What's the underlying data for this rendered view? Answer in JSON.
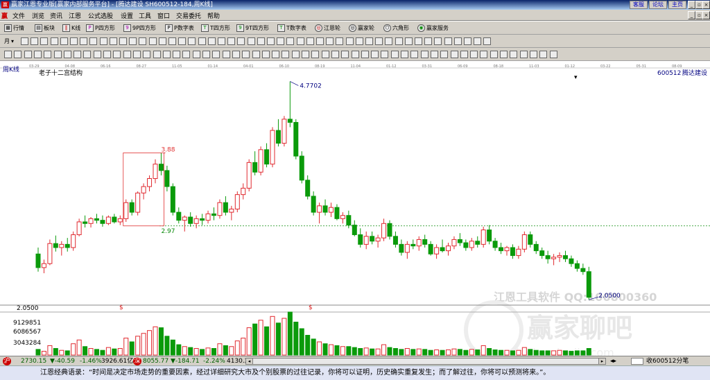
{
  "window": {
    "title": "赢家江恩专业版[赢家内部服务平台] - [腾达建设  SH600512-184,周K线]",
    "links": [
      "客服",
      "论坛",
      "主页"
    ],
    "logo_char": "赢"
  },
  "menu": [
    "文件",
    "浏览",
    "资讯",
    "江恩",
    "公式选股",
    "设置",
    "工具",
    "窗口",
    "交易委托",
    "帮助"
  ],
  "toolbar1": [
    "行情",
    "板块",
    "K线",
    "P四方形",
    "9P四方形",
    "P数字表",
    "T四方形",
    "9T四方形",
    "T数字表",
    "江恩轮",
    "赢家轮",
    "六角形",
    "赢家服务"
  ],
  "toolbar2": {
    "period": "月"
  },
  "chart_header": {
    "period_label": "周K线",
    "indicator": "老子十二宫结构",
    "code": "600512",
    "name": "腾达建设",
    "ann_high": "4.7702",
    "ann_box_high": "3.88",
    "ann_box_low": "2.97",
    "ann_low": "2.0500",
    "dollar": "$",
    "watermark1": "江恩工具软件 QQ:100800360",
    "watermark2": "赢家聊吧",
    "watermark3": "jiaoba.yingjia.com"
  },
  "colors": {
    "up": "#e0282e",
    "down": "#0a9a0a",
    "axis": "#000080",
    "dash_up": "#e03030",
    "dash_low": "#0a8a0a"
  },
  "date_axis": [
    "03-29",
    "04-08",
    "06-16",
    "08-27",
    "11-05",
    "01-14",
    "04-01",
    "06-10",
    "08-19",
    "11-04",
    "01-12",
    "03-31",
    "06-09",
    "08-18",
    "11-03",
    "01-12",
    "03-22",
    "05-31",
    "08-09"
  ],
  "volume_axis": [
    "9129851",
    "6086567",
    "3043284"
  ],
  "price_axis": "2.0500",
  "status": {
    "sh": "2730.15",
    "sh_change": "▼-40.59",
    "sh_pct": "-1.46%",
    "sh_amount": "3926.61亿",
    "sz": "8055.77",
    "sz_change": "▼-184.71",
    "sz_pct": "-2.24%",
    "sz_amount": "4130.2",
    "right_text": "收600512分笔",
    "logo_char": "沪",
    "logo2_char": "深"
  },
  "quote_text": "江恩经典语录：“时间是决定市场走势的重要因素，经过详细研究大市及个别股票的过往记录，你将可以证明，历史确实重复发生；而了解过往，你将可以预测将来。”。",
  "chart_data": {
    "type": "candlestick",
    "title": "老子十二宫结构",
    "xlabel": "",
    "ylabel": "",
    "ylim": [
      2.0,
      4.8
    ],
    "markers": {
      "high": 4.7702,
      "box_high": 3.88,
      "box_low": 2.97,
      "low": 2.05
    },
    "ohlc": [
      [
        2.62,
        2.7,
        2.4,
        2.45
      ],
      [
        2.45,
        2.55,
        2.38,
        2.5
      ],
      [
        2.5,
        2.8,
        2.48,
        2.75
      ],
      [
        2.75,
        2.85,
        2.65,
        2.7
      ],
      [
        2.7,
        2.78,
        2.6,
        2.74
      ],
      [
        2.74,
        2.82,
        2.65,
        2.7
      ],
      [
        2.7,
        2.9,
        2.66,
        2.86
      ],
      [
        2.86,
        3.06,
        2.84,
        3.02
      ],
      [
        3.02,
        3.1,
        2.95,
        3.0
      ],
      [
        3.0,
        3.08,
        2.95,
        3.06
      ],
      [
        3.06,
        3.12,
        3.0,
        3.04
      ],
      [
        3.04,
        3.1,
        2.96,
        3.0
      ],
      [
        3.0,
        3.1,
        2.98,
        3.08
      ],
      [
        3.08,
        3.12,
        3.0,
        3.02
      ],
      [
        3.02,
        3.1,
        2.98,
        3.06
      ],
      [
        3.06,
        3.3,
        3.02,
        3.26
      ],
      [
        3.26,
        3.3,
        3.1,
        3.14
      ],
      [
        3.14,
        3.4,
        3.1,
        3.38
      ],
      [
        3.38,
        3.5,
        3.3,
        3.46
      ],
      [
        3.46,
        3.6,
        3.4,
        3.56
      ],
      [
        3.56,
        3.8,
        3.5,
        3.74
      ],
      [
        3.74,
        3.88,
        3.6,
        3.66
      ],
      [
        3.66,
        3.72,
        3.4,
        3.46
      ],
      [
        3.46,
        3.5,
        3.1,
        3.14
      ],
      [
        3.14,
        3.2,
        3.0,
        3.04
      ],
      [
        3.04,
        3.1,
        2.9,
        3.08
      ],
      [
        3.08,
        3.14,
        2.96,
        3.0
      ],
      [
        3.0,
        3.1,
        2.94,
        3.06
      ],
      [
        3.06,
        3.12,
        2.98,
        3.04
      ],
      [
        3.04,
        3.16,
        3.0,
        3.12
      ],
      [
        3.12,
        3.2,
        3.04,
        3.1
      ],
      [
        3.1,
        3.3,
        3.06,
        3.26
      ],
      [
        3.26,
        3.34,
        3.1,
        3.14
      ],
      [
        3.14,
        3.22,
        3.04,
        3.18
      ],
      [
        3.18,
        3.4,
        3.14,
        3.36
      ],
      [
        3.36,
        3.5,
        3.3,
        3.44
      ],
      [
        3.44,
        3.8,
        3.4,
        3.76
      ],
      [
        3.76,
        3.9,
        3.6,
        3.64
      ],
      [
        3.64,
        3.96,
        3.6,
        3.92
      ],
      [
        3.92,
        4.0,
        3.7,
        3.74
      ],
      [
        3.74,
        4.2,
        3.7,
        4.16
      ],
      [
        4.16,
        4.3,
        3.96,
        4.0
      ],
      [
        4.0,
        4.34,
        3.96,
        4.3
      ],
      [
        4.3,
        4.77,
        4.2,
        4.26
      ],
      [
        4.26,
        4.3,
        3.8,
        3.84
      ],
      [
        3.84,
        3.9,
        3.5,
        3.54
      ],
      [
        3.54,
        3.6,
        3.3,
        3.34
      ],
      [
        3.34,
        3.4,
        3.1,
        3.14
      ],
      [
        3.14,
        3.26,
        3.0,
        3.22
      ],
      [
        3.22,
        3.3,
        3.1,
        3.14
      ],
      [
        3.14,
        3.26,
        3.08,
        3.2
      ],
      [
        3.2,
        3.24,
        3.04,
        3.06
      ],
      [
        3.06,
        3.14,
        3.0,
        3.1
      ],
      [
        3.1,
        3.16,
        2.94,
        2.98
      ],
      [
        2.98,
        3.04,
        2.84,
        2.86
      ],
      [
        2.86,
        2.94,
        2.7,
        2.74
      ],
      [
        2.74,
        2.9,
        2.68,
        2.84
      ],
      [
        2.84,
        2.9,
        2.74,
        2.78
      ],
      [
        2.78,
        2.86,
        2.7,
        2.82
      ],
      [
        2.82,
        3.06,
        2.78,
        3.0
      ],
      [
        3.0,
        3.04,
        2.8,
        2.84
      ],
      [
        2.84,
        2.9,
        2.7,
        2.74
      ],
      [
        2.74,
        2.8,
        2.6,
        2.64
      ],
      [
        2.64,
        2.78,
        2.56,
        2.74
      ],
      [
        2.74,
        2.8,
        2.68,
        2.72
      ],
      [
        2.72,
        2.84,
        2.66,
        2.8
      ],
      [
        2.8,
        2.86,
        2.7,
        2.74
      ],
      [
        2.74,
        2.78,
        2.6,
        2.62
      ],
      [
        2.62,
        2.74,
        2.56,
        2.7
      ],
      [
        2.7,
        2.8,
        2.64,
        2.66
      ],
      [
        2.66,
        2.76,
        2.6,
        2.72
      ],
      [
        2.72,
        2.84,
        2.68,
        2.8
      ],
      [
        2.8,
        2.88,
        2.72,
        2.76
      ],
      [
        2.76,
        2.8,
        2.66,
        2.7
      ],
      [
        2.7,
        2.82,
        2.66,
        2.78
      ],
      [
        2.78,
        2.84,
        2.7,
        2.74
      ],
      [
        2.74,
        2.96,
        2.7,
        2.92
      ],
      [
        2.92,
        2.98,
        2.74,
        2.78
      ],
      [
        2.78,
        2.82,
        2.66,
        2.7
      ],
      [
        2.7,
        2.76,
        2.62,
        2.66
      ],
      [
        2.66,
        2.72,
        2.6,
        2.7
      ],
      [
        2.7,
        2.74,
        2.56,
        2.6
      ],
      [
        2.6,
        2.72,
        2.56,
        2.68
      ],
      [
        2.68,
        2.9,
        2.64,
        2.86
      ],
      [
        2.86,
        2.9,
        2.7,
        2.74
      ],
      [
        2.74,
        2.78,
        2.62,
        2.66
      ],
      [
        2.66,
        2.7,
        2.56,
        2.6
      ],
      [
        2.6,
        2.66,
        2.5,
        2.56
      ],
      [
        2.56,
        2.62,
        2.48,
        2.58
      ],
      [
        2.58,
        2.64,
        2.52,
        2.6
      ],
      [
        2.6,
        2.66,
        2.52,
        2.56
      ],
      [
        2.56,
        2.6,
        2.46,
        2.5
      ],
      [
        2.5,
        2.54,
        2.4,
        2.44
      ],
      [
        2.44,
        2.5,
        2.36,
        2.4
      ],
      [
        2.4,
        2.46,
        2.05,
        2.08
      ]
    ],
    "volume": [
      1.2,
      0.8,
      2.0,
      1.4,
      1.0,
      0.9,
      2.4,
      3.2,
      1.8,
      1.4,
      1.2,
      1.0,
      1.6,
      1.3,
      1.4,
      3.6,
      2.8,
      4.0,
      4.6,
      5.2,
      6.0,
      5.8,
      4.0,
      3.2,
      2.2,
      1.8,
      1.6,
      1.4,
      1.2,
      1.5,
      1.4,
      2.4,
      2.0,
      1.8,
      3.0,
      3.6,
      5.8,
      6.6,
      7.4,
      6.0,
      8.2,
      6.8,
      7.8,
      9.13,
      7.0,
      5.6,
      4.2,
      3.4,
      2.8,
      2.4,
      2.2,
      2.0,
      1.8,
      1.8,
      1.6,
      1.4,
      1.5,
      1.3,
      1.3,
      2.2,
      1.6,
      1.4,
      1.2,
      1.4,
      1.2,
      1.3,
      1.2,
      1.0,
      1.1,
      1.0,
      1.1,
      1.3,
      1.2,
      1.0,
      1.2,
      1.1,
      2.0,
      1.4,
      1.1,
      1.0,
      1.0,
      0.9,
      1.0,
      1.6,
      1.2,
      1.0,
      0.9,
      0.9,
      0.9,
      1.0,
      0.9,
      0.8,
      0.9,
      0.9,
      1.4
    ]
  }
}
